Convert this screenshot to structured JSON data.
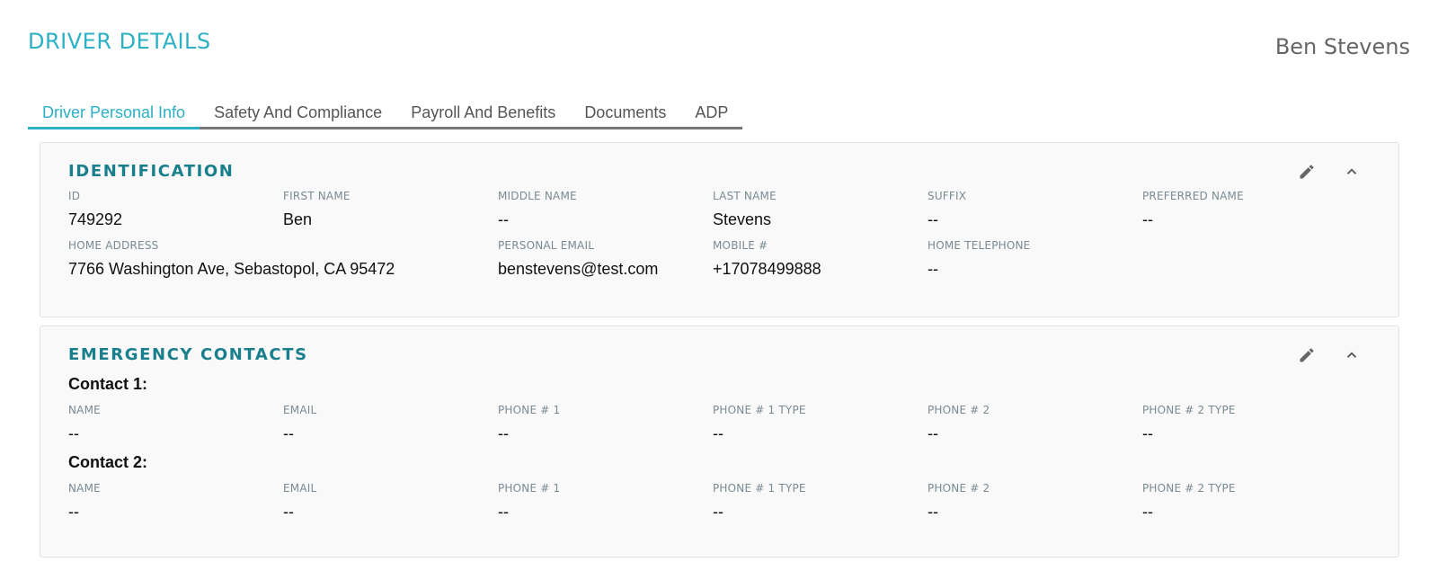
{
  "header": {
    "title": "DRIVER DETAILS",
    "driver_name": "Ben Stevens"
  },
  "tabs": [
    {
      "label": "Driver Personal Info",
      "active": true
    },
    {
      "label": "Safety And Compliance",
      "active": false
    },
    {
      "label": "Payroll And Benefits",
      "active": false
    },
    {
      "label": "Documents",
      "active": false
    },
    {
      "label": "ADP",
      "active": false
    }
  ],
  "identification": {
    "title": "IDENTIFICATION",
    "fields": {
      "id": {
        "label": "ID",
        "value": "749292"
      },
      "first_name": {
        "label": "FIRST NAME",
        "value": "Ben"
      },
      "middle_name": {
        "label": "MIDDLE NAME",
        "value": "--"
      },
      "last_name": {
        "label": "LAST NAME",
        "value": "Stevens"
      },
      "suffix": {
        "label": "SUFFIX",
        "value": "--"
      },
      "preferred_name": {
        "label": "PREFERRED NAME",
        "value": "--"
      },
      "home_address": {
        "label": "HOME ADDRESS",
        "value": "7766 Washington Ave, Sebastopol, CA 95472"
      },
      "personal_email": {
        "label": "PERSONAL EMAIL",
        "value": "benstevens@test.com"
      },
      "mobile": {
        "label": "MOBILE #",
        "value": "+17078499888"
      },
      "home_telephone": {
        "label": "HOME TELEPHONE",
        "value": "--"
      }
    }
  },
  "emergency_contacts": {
    "title": "EMERGENCY CONTACTS",
    "contacts": [
      {
        "heading": "Contact 1:",
        "fields": [
          {
            "label": "NAME",
            "value": "--"
          },
          {
            "label": "EMAIL",
            "value": "--"
          },
          {
            "label": "PHONE # 1",
            "value": "--"
          },
          {
            "label": "PHONE # 1 TYPE",
            "value": "--"
          },
          {
            "label": "PHONE # 2",
            "value": "--"
          },
          {
            "label": "PHONE # 2 TYPE",
            "value": "--"
          }
        ]
      },
      {
        "heading": "Contact 2:",
        "fields": [
          {
            "label": "NAME",
            "value": "--"
          },
          {
            "label": "EMAIL",
            "value": "--"
          },
          {
            "label": "PHONE # 1",
            "value": "--"
          },
          {
            "label": "PHONE # 1 TYPE",
            "value": "--"
          },
          {
            "label": "PHONE # 2",
            "value": "--"
          },
          {
            "label": "PHONE # 2 TYPE",
            "value": "--"
          }
        ]
      }
    ]
  },
  "icons": {
    "edit": "pencil-icon",
    "collapse": "chevron-up-icon"
  },
  "colors": {
    "accent": "#2bb0c4",
    "section_title": "#1a7f8c"
  }
}
